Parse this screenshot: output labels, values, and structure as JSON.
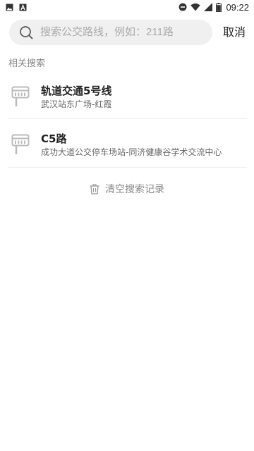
{
  "status_bar": {
    "time": "09:22",
    "battery_level": 0.9,
    "left_icons": [
      "image-notification-icon",
      "text-notification-icon"
    ],
    "right_icons": [
      "do-not-disturb-icon",
      "wifi-icon",
      "signal-icon",
      "battery-icon"
    ]
  },
  "search": {
    "placeholder": "搜索公交路线，例如：211路",
    "value": "",
    "cancel_label": "取消"
  },
  "related": {
    "section_title": "相关搜索",
    "items": [
      {
        "title": "轨道交通5号线",
        "subtitle": "武汉站东广场-红霞",
        "icon": "bus-stop-icon"
      },
      {
        "title": "C5路",
        "subtitle": "成功大道公交停车场站-同济健康谷学术交流中心",
        "icon": "bus-stop-icon"
      }
    ]
  },
  "clear_history": {
    "label": "清空搜索记录",
    "icon": "trash-icon"
  },
  "colors": {
    "search_bg": "#f0f0f0",
    "title_text": "#222222",
    "secondary_text": "#888888",
    "icon_gray": "#bbbbbb"
  }
}
